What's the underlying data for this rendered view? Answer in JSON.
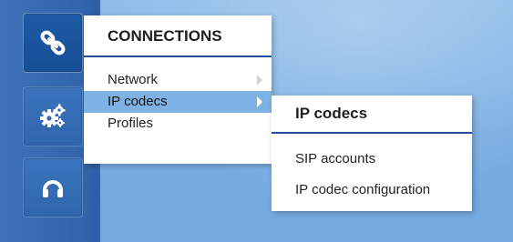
{
  "sidebar": {
    "tiles": [
      {
        "icon": "link-icon",
        "active": true
      },
      {
        "icon": "gears-icon",
        "active": false
      },
      {
        "icon": "headset-icon",
        "active": false
      }
    ]
  },
  "connections_menu": {
    "title": "CONNECTIONS",
    "items": [
      {
        "label": "Network",
        "has_submenu": true
      },
      {
        "label": "IP codecs",
        "has_submenu": true,
        "highlighted": true
      },
      {
        "label": "Profiles",
        "has_submenu": false
      }
    ]
  },
  "ip_codecs_submenu": {
    "title": "IP codecs",
    "items": [
      {
        "label": "SIP accounts"
      },
      {
        "label": "IP codec configuration"
      }
    ]
  },
  "colors": {
    "background": "#7faee0",
    "rail": "#2f62a8",
    "highlight": "#7cb2e4",
    "title_underline": "#1f4f9a"
  }
}
